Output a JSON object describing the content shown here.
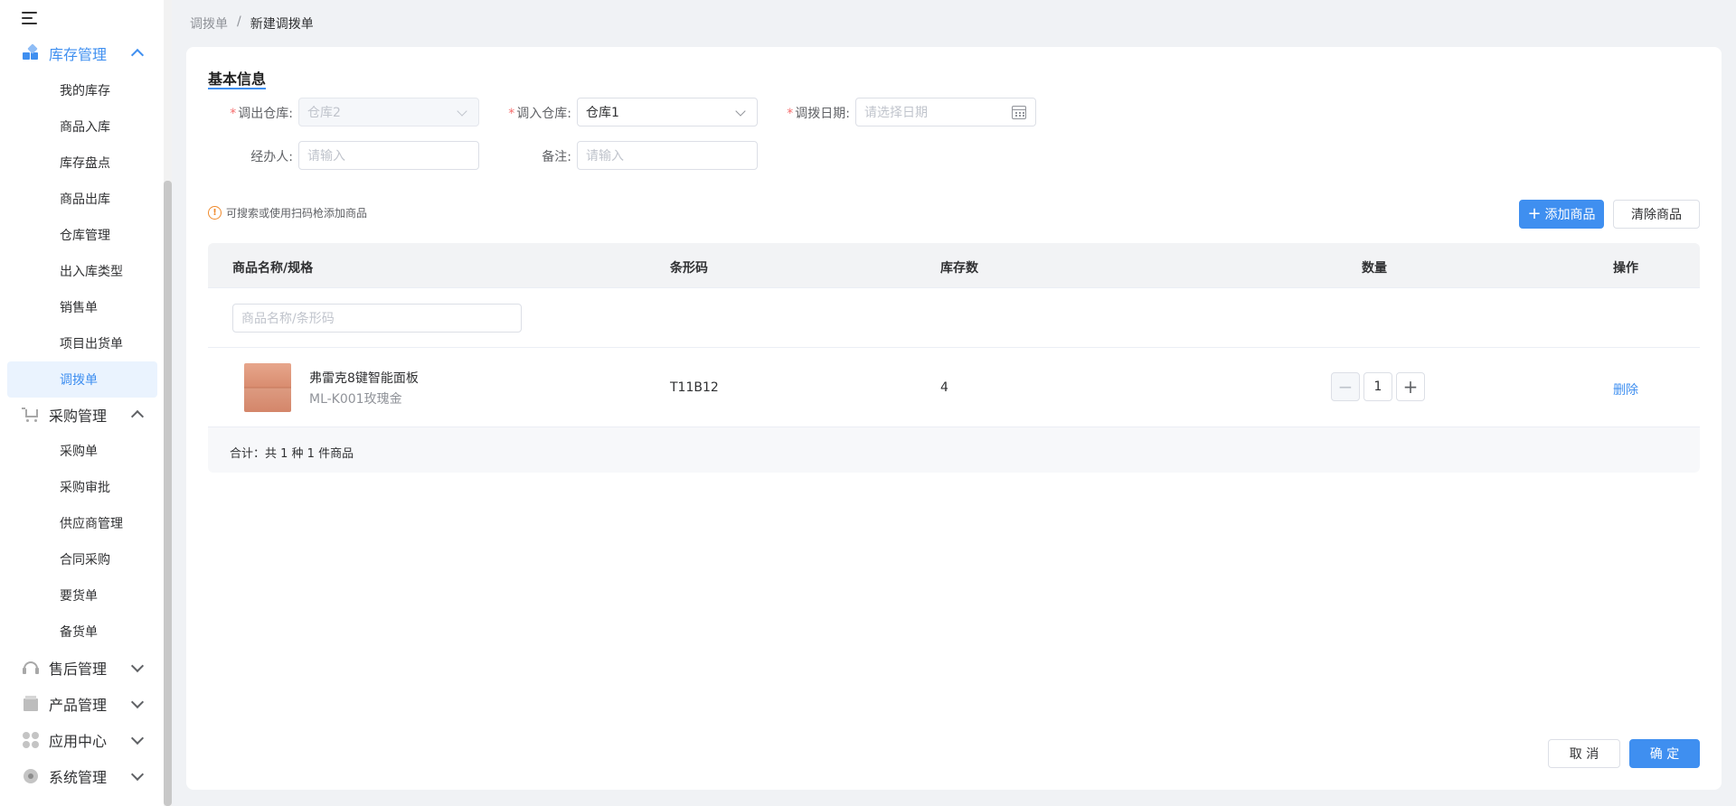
{
  "sidebar": {
    "groups": [
      {
        "label": "库存管理",
        "icon": "inventory-icon",
        "expanded": true,
        "active": true
      },
      {
        "label": "采购管理",
        "icon": "cart-icon",
        "expanded": true
      },
      {
        "label": "售后管理",
        "icon": "headset-icon",
        "expanded": false
      },
      {
        "label": "产品管理",
        "icon": "box-icon",
        "expanded": false
      },
      {
        "label": "应用中心",
        "icon": "apps-icon",
        "expanded": false
      },
      {
        "label": "系统管理",
        "icon": "settings-icon",
        "expanded": false
      }
    ],
    "inventory_items": [
      "我的库存",
      "商品入库",
      "库存盘点",
      "商品出库",
      "仓库管理",
      "出入库类型",
      "销售单",
      "项目出货单",
      "调拨单"
    ],
    "purchase_items": [
      "采购单",
      "采购审批",
      "供应商管理",
      "合同采购",
      "要货单",
      "备货单"
    ]
  },
  "breadcrumb": {
    "parent": "调拨单",
    "separator": "/",
    "current": "新建调拨单"
  },
  "form": {
    "title": "基本信息",
    "out_warehouse_label": "调出仓库:",
    "out_warehouse_value": "仓库2",
    "in_warehouse_label": "调入仓库:",
    "in_warehouse_value": "仓库1",
    "date_label": "调拨日期:",
    "date_placeholder": "请选择日期",
    "handler_label": "经办人:",
    "handler_placeholder": "请输入",
    "remark_label": "备注:",
    "remark_placeholder": "请输入",
    "required_mark": "*"
  },
  "tip": "可搜索或使用扫码枪添加商品",
  "actions": {
    "add_product": "添加商品",
    "clear_product": "清除商品"
  },
  "table": {
    "headers": [
      "商品名称/规格",
      "条形码",
      "库存数",
      "数量",
      "操作"
    ],
    "search_placeholder": "商品名称/条形码",
    "rows": [
      {
        "name": "弗雷克8键智能面板",
        "spec": "ML-K001玫瑰金",
        "barcode": "T11B12",
        "stock": "4",
        "quantity": "1",
        "action": "删除"
      }
    ],
    "summary": "合计：共 1 种 1 件商品"
  },
  "footer": {
    "cancel": "取 消",
    "confirm": "确 定"
  }
}
